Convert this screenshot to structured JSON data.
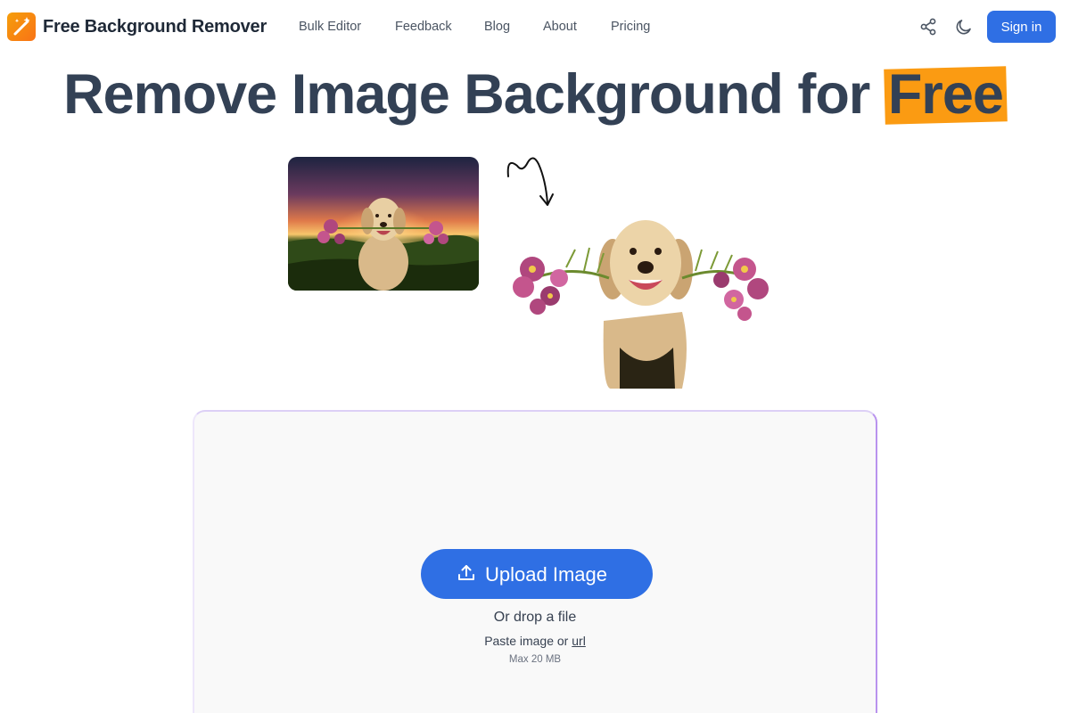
{
  "header": {
    "brand": "Free Background Remover",
    "nav": [
      "Bulk Editor",
      "Feedback",
      "Blog",
      "About",
      "Pricing"
    ],
    "icons": [
      "share-icon",
      "moon-icon"
    ],
    "signin_label": "Sign in"
  },
  "hero": {
    "title_main": "Remove Image Background for",
    "title_highlight": "Free",
    "highlight_color": "#fb9b12"
  },
  "upload": {
    "button_label": "Upload Image",
    "drop_text": "Or drop a file",
    "paste_prefix": "Paste image or",
    "paste_link": "url",
    "max_size": "Max 20 MB"
  },
  "colors": {
    "accent": "#2f6fe4",
    "title": "#334155",
    "panel_border": "#b993ee"
  }
}
